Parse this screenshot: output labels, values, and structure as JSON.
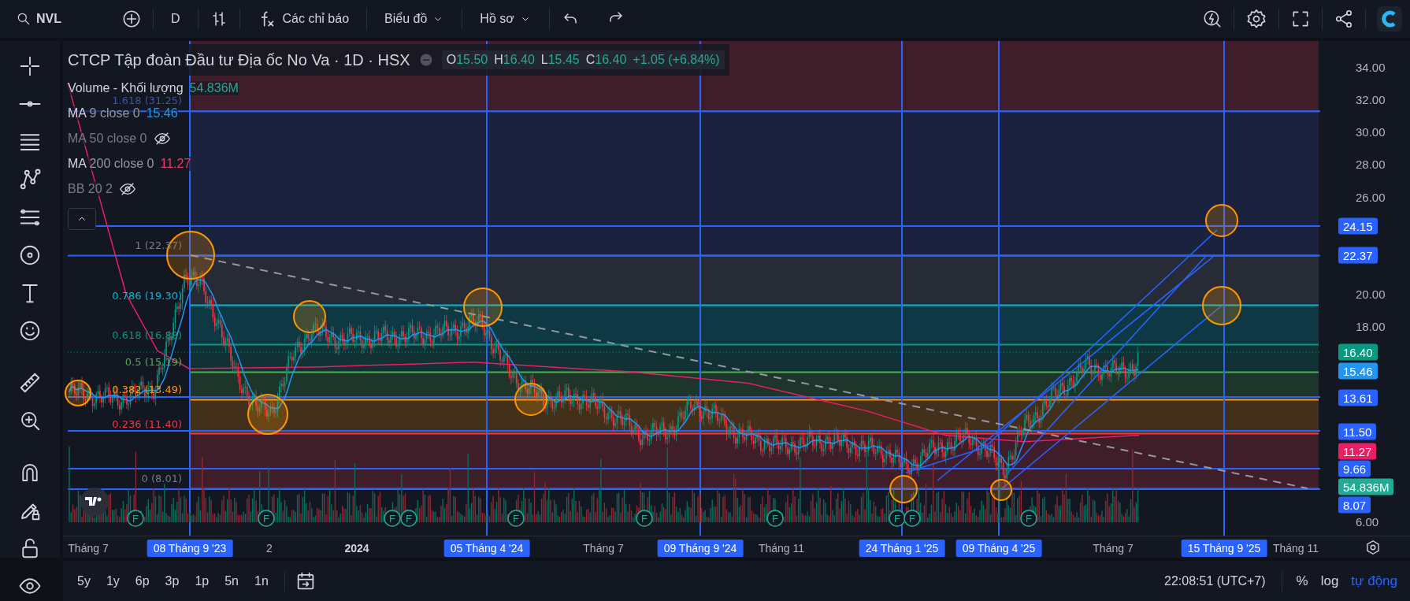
{
  "toolbar": {
    "symbol": "NVL",
    "interval": "D",
    "indicators": "Các chỉ báo",
    "chart_menu": "Biểu đồ",
    "profile_menu": "Hồ sơ"
  },
  "legend": {
    "title": "CTCP Tập đoàn Đầu tư Địa ốc No Va · 1D · HSX",
    "ohlc": [
      {
        "key": "O",
        "value": "15.50"
      },
      {
        "key": "H",
        "value": "16.40"
      },
      {
        "key": "L",
        "value": "15.45"
      },
      {
        "key": "C",
        "value": "16.40"
      }
    ],
    "change": "+1.05 (+6.84%)",
    "indicators": [
      {
        "name": "Volume - Khối lượng",
        "value": "54.836M",
        "color": "#22ab94",
        "visible": true
      },
      {
        "name": "MA",
        "params": "9 close 0",
        "value": "15.46",
        "color": "#2196f3",
        "visible": true
      },
      {
        "name": "MA",
        "params": "50 close 0",
        "visible": false
      },
      {
        "name": "MA",
        "params": "200 close 0",
        "value": "11.27",
        "color": "#f23668",
        "visible": true
      },
      {
        "name": "BB",
        "params": "20 2",
        "visible": false
      }
    ]
  },
  "fib_levels": [
    {
      "label": "1.618 (31.25)",
      "color": "#3a52a8"
    },
    {
      "label": "1 (22.37)",
      "color": "#787b86"
    },
    {
      "label": "0.786 (19.30)",
      "color": "#00bcd4"
    },
    {
      "label": "0.618 (16.88)",
      "color": "#089981"
    },
    {
      "label": "0.5 (15.19)",
      "color": "#4caf50"
    },
    {
      "label": "0.382 (13.49)",
      "color": "#ff9800"
    },
    {
      "label": "0.236 (11.40)",
      "color": "#f23645"
    },
    {
      "label": "0 (8.01)",
      "color": "#787b86"
    }
  ],
  "earnings_badges": [
    {
      "label": "F"
    },
    {
      "label": "F"
    },
    {
      "label": "F"
    },
    {
      "label": "F"
    },
    {
      "label": "F"
    },
    {
      "label": "F"
    },
    {
      "label": "F"
    },
    {
      "label": "F"
    },
    {
      "label": "F"
    },
    {
      "label": "F"
    }
  ],
  "price_axis": {
    "ticks": [
      "34.00",
      "32.00",
      "30.00",
      "28.00",
      "26.00",
      "20.00",
      "18.00",
      "6.00"
    ],
    "markers": [
      {
        "value": "24.15",
        "color": "#2962ff"
      },
      {
        "value": "22.37",
        "color": "#2962ff"
      },
      {
        "value": "16.40",
        "color": "#089981"
      },
      {
        "value": "15.46",
        "color": "#2196f3"
      },
      {
        "value": "13.61",
        "color": "#2962ff"
      },
      {
        "value": "11.50",
        "color": "#2962ff"
      },
      {
        "value": "11.27",
        "color": "#e91e63"
      },
      {
        "value": "9.66",
        "color": "#2962ff"
      },
      {
        "value": "54.836M",
        "color": "#22ab94"
      },
      {
        "value": "8.07",
        "color": "#2962ff"
      }
    ]
  },
  "time_axis": [
    {
      "label": "Tháng 7",
      "kind": "month"
    },
    {
      "label": "08 Tháng 9 '23",
      "kind": "marker"
    },
    {
      "label": "2",
      "kind": "month"
    },
    {
      "label": "2024",
      "kind": "year"
    },
    {
      "label": "05 Tháng 4 '24",
      "kind": "marker"
    },
    {
      "label": "Tháng 7",
      "kind": "month"
    },
    {
      "label": "09 Tháng 9 '24",
      "kind": "marker"
    },
    {
      "label": "Tháng 11",
      "kind": "month"
    },
    {
      "label": "24 Tháng 1 '25",
      "kind": "marker"
    },
    {
      "label": "09 Tháng 4 '25",
      "kind": "marker"
    },
    {
      "label": "Tháng 7",
      "kind": "month"
    },
    {
      "label": "15 Tháng 9 '25",
      "kind": "marker"
    },
    {
      "label": "Tháng 11",
      "kind": "month"
    }
  ],
  "bottom_bar": {
    "ranges": [
      "5y",
      "1y",
      "6p",
      "3p",
      "1p",
      "5n",
      "1n"
    ],
    "time": "22:08:51 (UTC+7)",
    "options": [
      {
        "label": "%",
        "selected": false
      },
      {
        "label": "log",
        "selected": false
      },
      {
        "label": "tự động",
        "selected": true
      }
    ]
  }
}
